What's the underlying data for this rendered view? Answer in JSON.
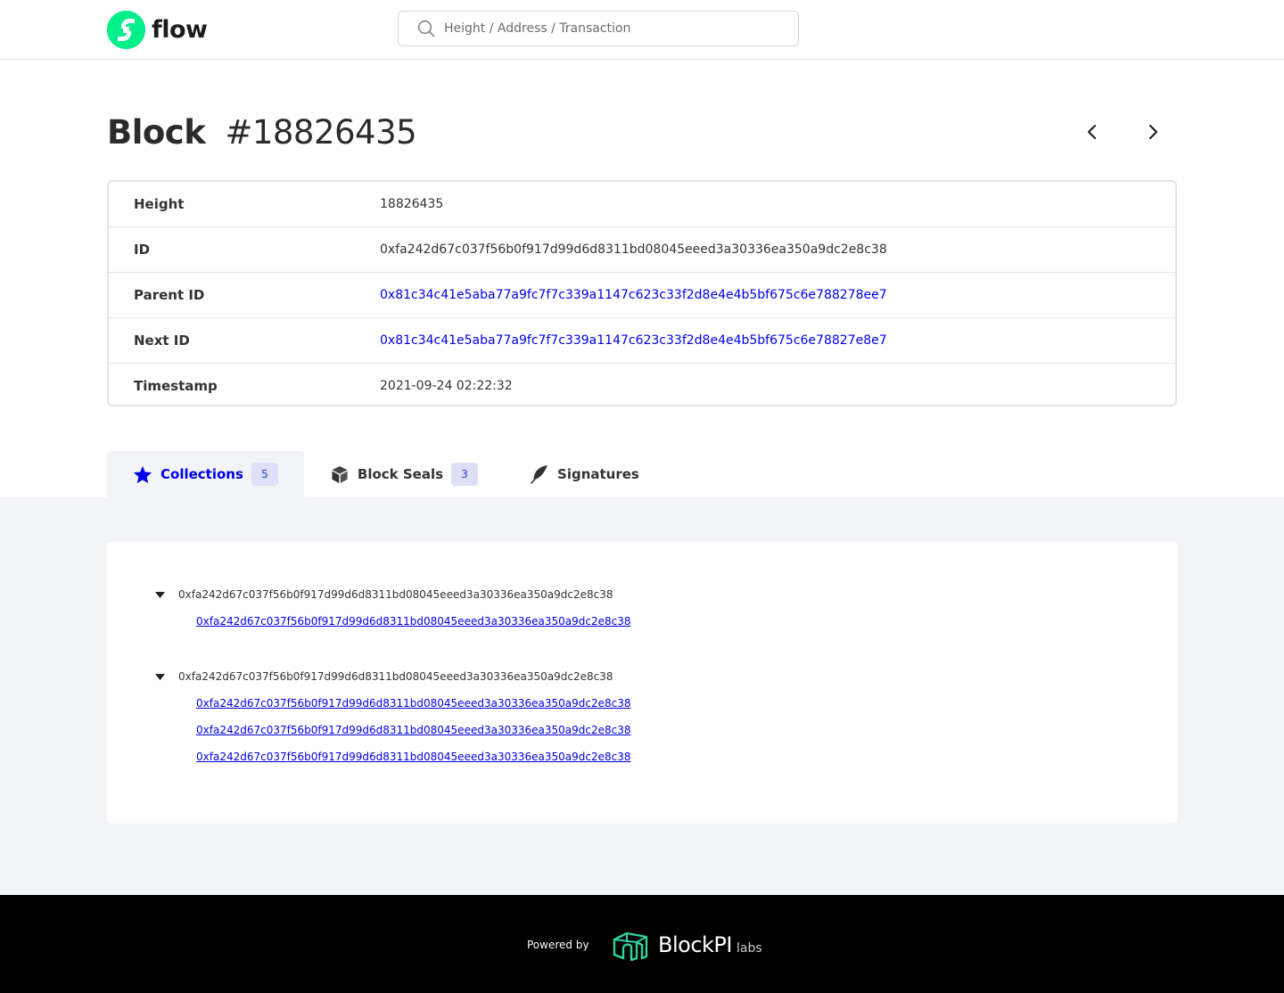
{
  "header": {
    "logo_text": "flow",
    "search_placeholder": "Height / Address / Transaction",
    "brand_color": "#00ef8b"
  },
  "title": {
    "label": "Block",
    "number": "#18826435"
  },
  "nav": {
    "prev_icon": "chevron-left-icon",
    "next_icon": "chevron-right-icon"
  },
  "info": [
    {
      "label": "Height",
      "value": "18826435",
      "is_link": false
    },
    {
      "label": "ID",
      "value": "0xfa242d67c037f56b0f917d99d6d8311bd08045eeed3a30336ea350a9dc2e8c38",
      "is_link": false
    },
    {
      "label": "Parent ID",
      "value": "0x81c34c41e5aba77a9fc7f7c339a1147c623c33f2d8e4e4b5bf675c6e788278ee7",
      "is_link": true
    },
    {
      "label": "Next ID",
      "value": "0x81c34c41e5aba77a9fc7f7c339a1147c623c33f2d8e4e4b5bf675c6e78827e8e7",
      "is_link": true
    },
    {
      "label": "Timestamp",
      "value": "2021-09-24 02:22:32",
      "is_link": false
    }
  ],
  "tabs": [
    {
      "label": "Collections",
      "badge": "5",
      "icon": "star-icon",
      "active": true
    },
    {
      "label": "Block Seals",
      "badge": "3",
      "icon": "cube-icon",
      "active": false
    },
    {
      "label": "Signatures",
      "badge": "",
      "icon": "feather-icon",
      "active": false
    }
  ],
  "collections": [
    {
      "id": "0xfa242d67c037f56b0f917d99d6d8311bd08045eeed3a30336ea350a9dc2e8c38",
      "transactions": [
        "0xfa242d67c037f56b0f917d99d6d8311bd08045eeed3a30336ea350a9dc2e8c38"
      ]
    },
    {
      "id": "0xfa242d67c037f56b0f917d99d6d8311bd08045eeed3a30336ea350a9dc2e8c38",
      "transactions": [
        "0xfa242d67c037f56b0f917d99d6d8311bd08045eeed3a30336ea350a9dc2e8c38",
        "0xfa242d67c037f56b0f917d99d6d8311bd08045eeed3a30336ea350a9dc2e8c38",
        "0xfa242d67c037f56b0f917d99d6d8311bd08045eeed3a30336ea350a9dc2e8c38"
      ]
    }
  ],
  "footer": {
    "powered_by": "Powered by",
    "brand_name": "BlockPI",
    "brand_sub": "labs",
    "brand_color": "#2ed3a0"
  }
}
